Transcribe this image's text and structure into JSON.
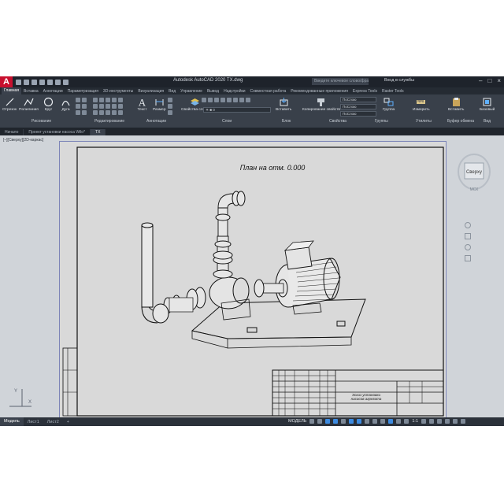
{
  "window": {
    "title": "Autodesk AutoCAD 2020   TX.dwg",
    "search_placeholder": "Введите ключевое слово/фразу",
    "signin": "Вход в службы",
    "logo": "A"
  },
  "ribbon_tabs": [
    "Главная",
    "Вставка",
    "Аннотации",
    "Параметризация",
    "3D-инструменты",
    "Визуализация",
    "Вид",
    "Управление",
    "Вывод",
    "Надстройки",
    "Совместная работа",
    "Рекомендованные приложения",
    "Express Tools",
    "Raster Tools"
  ],
  "ribbon": {
    "buttons": {
      "line": "Отрезок",
      "polyline": "Полилиния",
      "circle": "Круг",
      "arc": "Дуга",
      "text": "Текст",
      "dimension": "Размер",
      "layer_props": "Свойства слоев",
      "insert": "Вставить",
      "match_props": "Копирование свойств",
      "group": "Группа",
      "measure": "Измерить",
      "paste": "Вставить",
      "base": "Базовый"
    },
    "groups": [
      "Рисование",
      "Редактирование",
      "Аннотации",
      "Слои",
      "Блок",
      "Свойства",
      "Группы",
      "Утилиты",
      "Буфер обмена",
      "Вид"
    ],
    "layer_values": [
      "ПоСлою",
      "ПоСлою",
      "ПоСлою"
    ]
  },
  "file_tabs": [
    "Начало",
    "Проект установки насоса Wilo*",
    "TX"
  ],
  "workspace": {
    "view_label": "[–][Сверху][2D-каркас]",
    "drawing_title": "План на отм. 0.000",
    "title_block_caption_1": "Эскиз установки",
    "title_block_caption_2": "насосов агрегата"
  },
  "viewcube": {
    "face": "Сверху",
    "wcs": "МСК"
  },
  "status": {
    "tabs": [
      "Модель",
      "Лист1",
      "Лист2"
    ],
    "model_label": "МОДЕЛЬ",
    "scale": "1:1"
  },
  "colors": {
    "accent": "#c8102e",
    "dark": "#2b313a",
    "paper": "#d9d9d9"
  }
}
